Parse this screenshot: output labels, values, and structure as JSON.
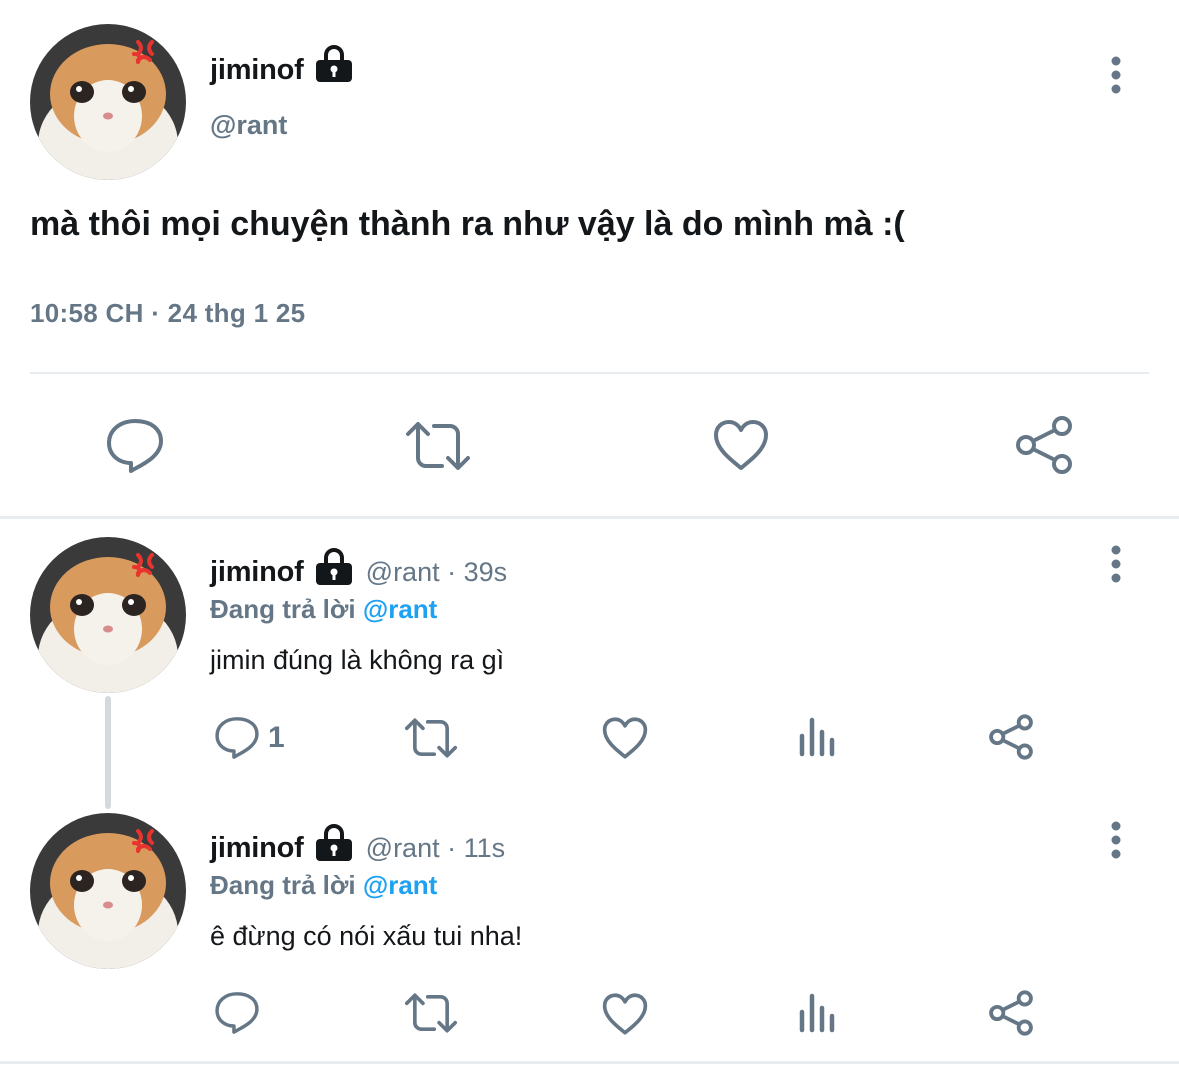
{
  "main_tweet": {
    "display_name": "jiminof",
    "handle": "@rant",
    "text": "mà thôi mọi chuyện thành ra như vậy là do mình mà :(",
    "timestamp": "10:58 CH · 24 thg 1 25",
    "actions": [
      "reply-icon",
      "retweet-icon",
      "like-icon",
      "share-icon"
    ]
  },
  "replies": [
    {
      "display_name": "jiminof",
      "handle_time": "@rant · 39s",
      "replying_label": "Đang trả lời",
      "replying_to": "@rant",
      "text": "jimin đúng là không ra gì",
      "reply_count": "1"
    },
    {
      "display_name": "jiminof",
      "handle_time": "@rant · 11s",
      "replying_label": "Đang trả lời",
      "replying_to": "@rant",
      "text": "ê đừng có nói xấu tui nha!",
      "reply_count": ""
    }
  ],
  "colors": {
    "text": "#14171a",
    "secondary": "#657786",
    "accent": "#1da1f2",
    "divider": "#e6ecf0",
    "angry_mark": "#e8332f"
  }
}
